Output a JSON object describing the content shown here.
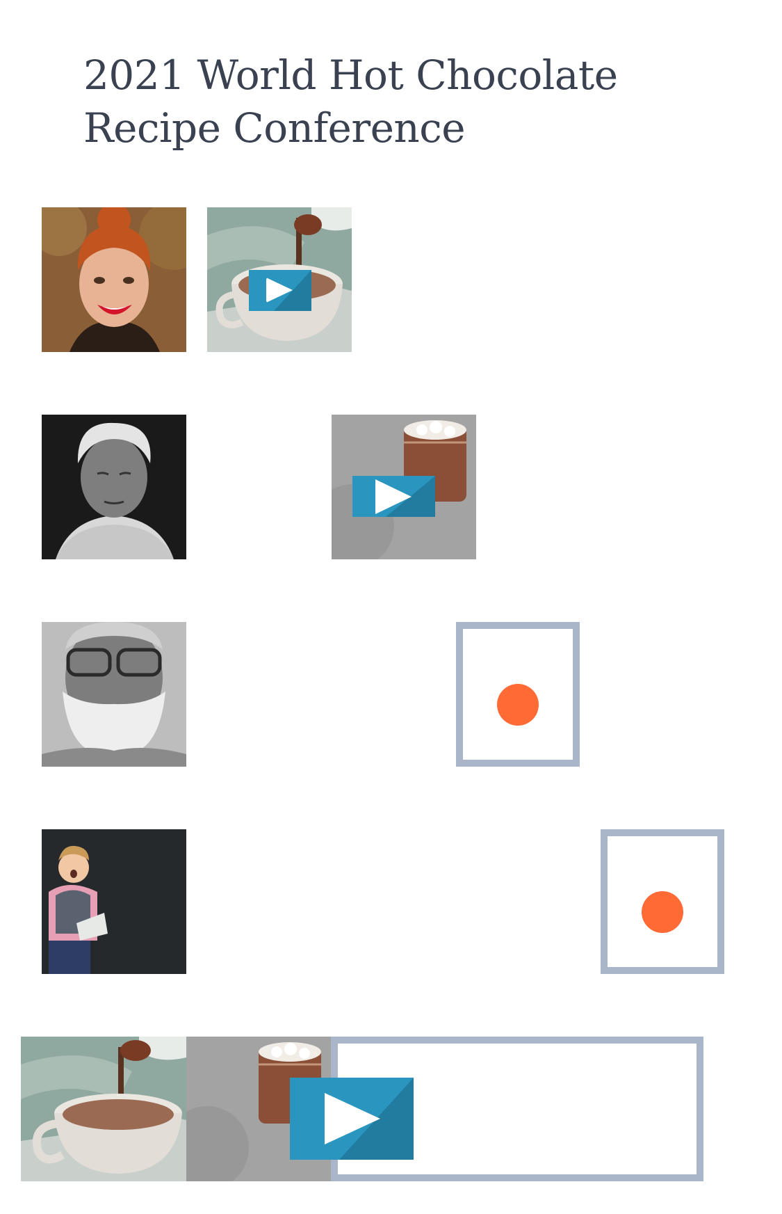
{
  "page": {
    "title_line1": "2021 World Hot Chocolate",
    "title_line2": "Recipe Conference"
  },
  "colors": {
    "title_text": "#3a4251",
    "play_button": "#2a95bf",
    "play_button_shade": "#217c9f",
    "frame_border": "#a9b5c9",
    "progress_dot": "#ff6a35"
  },
  "rows": [
    {
      "speaker": "red-haired-woman-portrait",
      "media": [
        "hot-chocolate-pour-video"
      ]
    },
    {
      "speaker": "elderly-woman-portrait",
      "media": [
        "jar-hot-chocolate-video"
      ]
    },
    {
      "speaker": "bearded-man-portrait",
      "media": [
        "placeholder-with-dot"
      ]
    },
    {
      "speaker": "surprised-boy-portrait",
      "media": [
        "placeholder-with-dot"
      ]
    },
    {
      "speaker": null,
      "media": [
        "hot-chocolate-pour-image",
        "jar-hot-chocolate-video",
        "empty-frame"
      ]
    }
  ],
  "icons": {
    "play": "play-icon",
    "dot": "record-dot-icon"
  }
}
